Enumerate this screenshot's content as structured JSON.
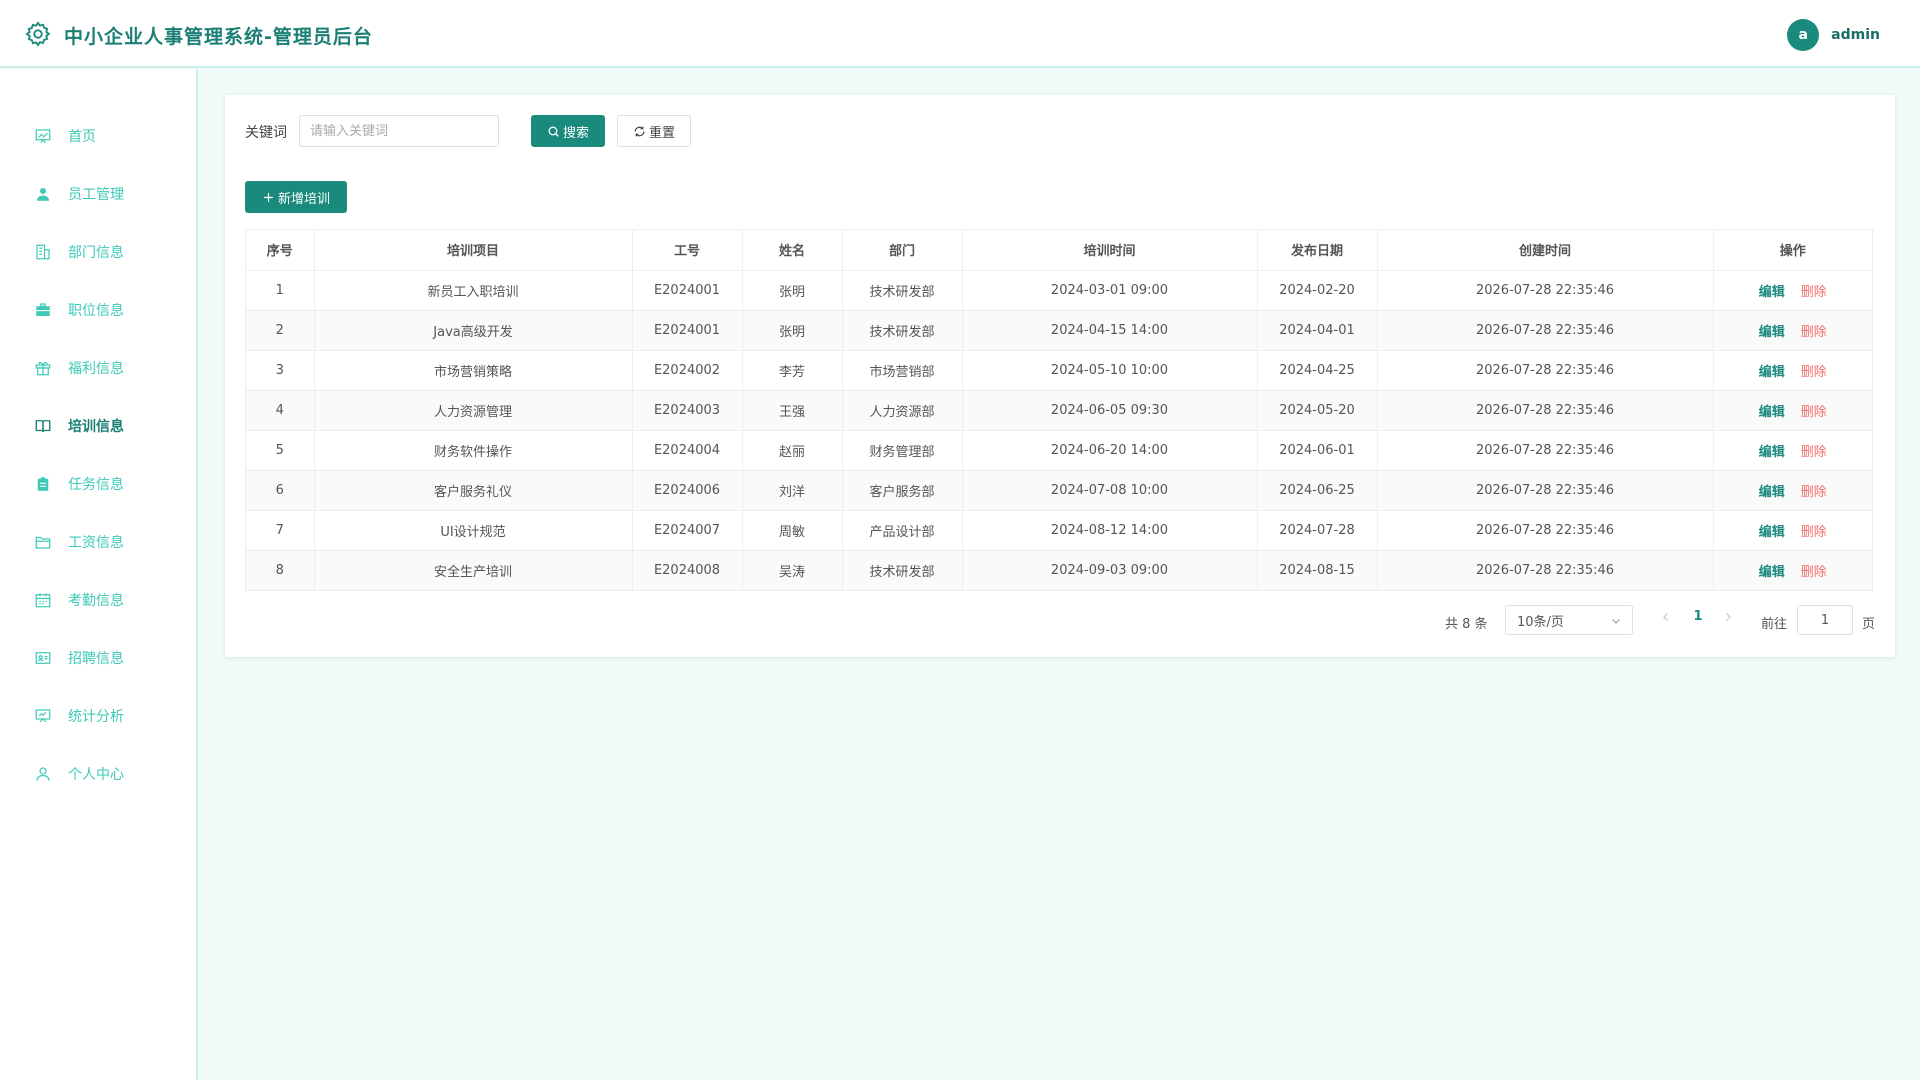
{
  "header": {
    "title": "中小企业人事管理系统-管理员后台",
    "avatar_letter": "a",
    "username": "admin"
  },
  "sidebar": {
    "items": [
      {
        "label": "首页",
        "icon": "chart-icon",
        "active": false
      },
      {
        "label": "员工管理",
        "icon": "user-icon",
        "active": false
      },
      {
        "label": "部门信息",
        "icon": "building-icon",
        "active": false
      },
      {
        "label": "职位信息",
        "icon": "briefcase-icon",
        "active": false
      },
      {
        "label": "福利信息",
        "icon": "gift-icon",
        "active": false
      },
      {
        "label": "培训信息",
        "icon": "book-icon",
        "active": true
      },
      {
        "label": "任务信息",
        "icon": "clipboard-icon",
        "active": false
      },
      {
        "label": "工资信息",
        "icon": "folder-icon",
        "active": false
      },
      {
        "label": "考勤信息",
        "icon": "calendar-icon",
        "active": false
      },
      {
        "label": "招聘信息",
        "icon": "id-card-icon",
        "active": false
      },
      {
        "label": "统计分析",
        "icon": "presentation-icon",
        "active": false
      },
      {
        "label": "个人中心",
        "icon": "person-icon",
        "active": false
      }
    ]
  },
  "search": {
    "label": "关键词",
    "placeholder": "请输入关键词",
    "value": "",
    "search_label": "搜索",
    "reset_label": "重置"
  },
  "toolbar": {
    "add_label": "新增培训"
  },
  "table": {
    "columns": [
      "序号",
      "培训项目",
      "工号",
      "姓名",
      "部门",
      "培训时间",
      "发布日期",
      "创建时间",
      "操作"
    ],
    "edit_label": "编辑",
    "delete_label": "删除",
    "rows": [
      {
        "no": "1",
        "project": "新员工入职培训",
        "emp_id": "E2024001",
        "name": "张明",
        "dept": "技术研发部",
        "train_time": "2024-03-01 09:00",
        "publish_date": "2024-02-20",
        "created": "2026-07-28 22:35:46"
      },
      {
        "no": "2",
        "project": "Java高级开发",
        "emp_id": "E2024001",
        "name": "张明",
        "dept": "技术研发部",
        "train_time": "2024-04-15 14:00",
        "publish_date": "2024-04-01",
        "created": "2026-07-28 22:35:46"
      },
      {
        "no": "3",
        "project": "市场营销策略",
        "emp_id": "E2024002",
        "name": "李芳",
        "dept": "市场营销部",
        "train_time": "2024-05-10 10:00",
        "publish_date": "2024-04-25",
        "created": "2026-07-28 22:35:46"
      },
      {
        "no": "4",
        "project": "人力资源管理",
        "emp_id": "E2024003",
        "name": "王强",
        "dept": "人力资源部",
        "train_time": "2024-06-05 09:30",
        "publish_date": "2024-05-20",
        "created": "2026-07-28 22:35:46"
      },
      {
        "no": "5",
        "project": "财务软件操作",
        "emp_id": "E2024004",
        "name": "赵丽",
        "dept": "财务管理部",
        "train_time": "2024-06-20 14:00",
        "publish_date": "2024-06-01",
        "created": "2026-07-28 22:35:46"
      },
      {
        "no": "6",
        "project": "客户服务礼仪",
        "emp_id": "E2024006",
        "name": "刘洋",
        "dept": "客户服务部",
        "train_time": "2024-07-08 10:00",
        "publish_date": "2024-06-25",
        "created": "2026-07-28 22:35:46"
      },
      {
        "no": "7",
        "project": "UI设计规范",
        "emp_id": "E2024007",
        "name": "周敏",
        "dept": "产品设计部",
        "train_time": "2024-08-12 14:00",
        "publish_date": "2024-07-28",
        "created": "2026-07-28 22:35:46"
      },
      {
        "no": "8",
        "project": "安全生产培训",
        "emp_id": "E2024008",
        "name": "吴涛",
        "dept": "技术研发部",
        "train_time": "2024-09-03 09:00",
        "publish_date": "2024-08-15",
        "created": "2026-07-28 22:35:46"
      }
    ]
  },
  "pagination": {
    "total_text": "共 8 条",
    "page_size": "10条/页",
    "current_page": "1",
    "goto_label": "前往",
    "goto_value": "1",
    "page_unit": "页"
  },
  "colors": {
    "primary": "#1a8a7d",
    "menu_text": "#3ec9b6",
    "danger": "#f56c6c",
    "background": "#f0faf8"
  }
}
